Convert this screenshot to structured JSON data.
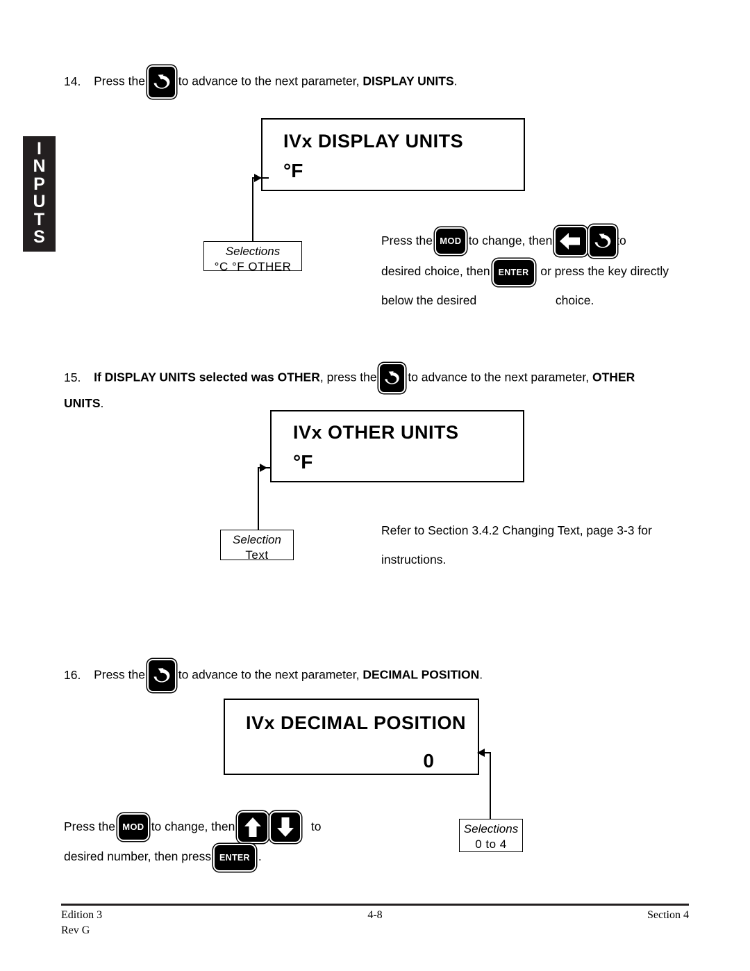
{
  "sidebar": {
    "tab_label": "INPUTS",
    "letters": [
      "I",
      "N",
      "P",
      "U",
      "T",
      "S"
    ]
  },
  "steps": [
    {
      "number": "14.",
      "text_before": "Press the",
      "icon": "advance-key-icon",
      "text_after_a": "to advance to the next parameter,",
      "emphasis": "DISPLAY UNITS",
      "text_after_b": "."
    },
    {
      "number": "15.",
      "emphasis_a": "If DISPLAY UNITS selected was OTHER",
      "text_a": ", press the",
      "icon": "advance-key-icon",
      "text_b": "to advance to the next parameter,",
      "emphasis_b": "OTHER",
      "emphasis_c": "UNITS",
      "text_c": "."
    },
    {
      "number": "16.",
      "text_before": "Press the",
      "icon": "advance-key-icon",
      "text_after_a": "to advance to the next parameter,",
      "emphasis": "DECIMAL POSITION",
      "text_after_b": "."
    }
  ],
  "displays": [
    {
      "title": "IVx  DISPLAY UNITS",
      "value": "°F",
      "value_align": "left"
    },
    {
      "title": "IVx  OTHER  UNITS",
      "value": "°F",
      "value_align": "left"
    },
    {
      "title": "IVx  DECIMAL  POSITION",
      "value": "0",
      "value_align": "right"
    }
  ],
  "callouts": [
    {
      "title": "Selections",
      "body": "°C   °F   OTHER"
    },
    {
      "title": "Selection",
      "body": "Text"
    },
    {
      "title": "Selections",
      "body": "0 to 4"
    }
  ],
  "instructions": {
    "display_units": {
      "line1_a": "Press the",
      "key_mod": "MOD",
      "line1_b": "to  change,  then",
      "key_left": "left-arrow-key-icon",
      "key_advance": "advance-key-icon",
      "line1_c": "to",
      "line2_a": "desired choice, then",
      "key_enter": "ENTER",
      "line2_b": ", or press the key directly",
      "line3_a": "below  the  desired",
      "line3_b": "choice."
    },
    "other_units": {
      "line1": "Refer to Section 3.4.2 Changing Text, page 3-3 for",
      "line2": "instructions."
    },
    "decimal_position": {
      "line1_a": "Press the",
      "key_mod": "MOD",
      "line1_b": "to  change,  then",
      "key_up": "up-arrow-key-icon",
      "key_down": "down-arrow-key-icon",
      "line1_c": "to",
      "line2_a": "desired number, then press",
      "key_enter": "ENTER",
      "line2_b": "."
    }
  },
  "footer": {
    "edition": "Edition 3",
    "revision": "Rev G",
    "page_number": "4-8",
    "section": "Section 4"
  },
  "colors": {
    "ink": "#000000",
    "tab_background": "#231f20",
    "paper": "#ffffff"
  }
}
